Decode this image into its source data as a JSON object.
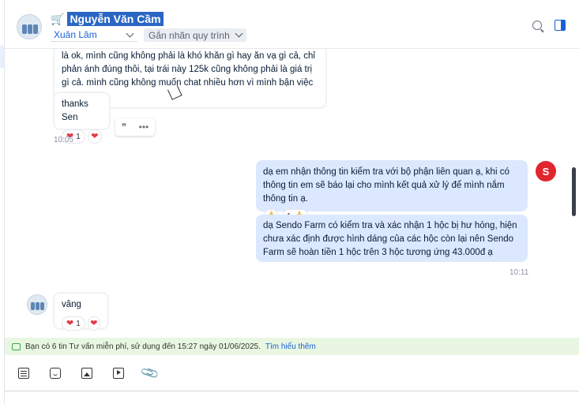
{
  "header": {
    "contact_name": "Nguyễn Văn Cầm",
    "cart_icon": "🛒",
    "assignee": "Xuân Lâm",
    "label_button": "Gắn nhãn quy trình"
  },
  "messages": {
    "m1_text": "là ok, mình cũng không phải là khó khăn gì hay ăn vạ gì cả, chỉ phản ánh đúng thôi, tại trái này 125k cũng không phải là giá trị gì cả. mình cũng không muốn chat nhiều hơn vì mình bận việc cty nữa ạ",
    "m2_text": "thanks Sen",
    "m2_reaction_count": "1",
    "m2_time": "10:05",
    "m3_text": "dạ em nhận thông tin kiểm tra với bộ phận liên quan ạ, khi có thông tin em sẽ báo lại cho mình kết quả xử lý để mình nắm thông tin ạ.",
    "m3_reaction_count": "1",
    "m4_text": "dạ Sendo Farm có kiểm tra và xác nhận 1 hộc bị hư hỏng, hiện chưa xác định được hình dáng của các hộc còn lại nên Sendo Farm sẽ hoàn tiền 1 hộc trên 3 hộc tương ứng 43.000đ ạ",
    "m4_time": "10:11",
    "m5_text": "vâng",
    "m5_reaction_count": "1",
    "sendo_avatar_text": "S"
  },
  "hover_tools": {
    "quote": "❞",
    "more": "•••"
  },
  "infobar": {
    "text": "Bạn có 6 tin Tư vấn miễn phí, sử dụng đến 15:27 ngày 01/06/2025.",
    "link": "Tìm hiểu thêm"
  },
  "toolbar": {
    "icons": [
      "text-template-icon",
      "sticker-icon",
      "image-icon",
      "video-icon",
      "attachment-icon"
    ]
  },
  "colors": {
    "accent": "#1a5fd4",
    "outgoing_bubble": "#dbe8fd",
    "infobar_bg": "#e9f7e2",
    "name_highlight": "#2a66c3"
  }
}
